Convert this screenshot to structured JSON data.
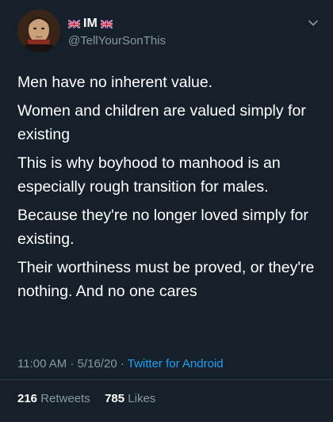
{
  "tweet": {
    "display_name": "IM",
    "handle": "@TellYourSonThis",
    "paragraphs": [
      "Men have no inherent value.",
      "Women and children are valued simply for existing",
      "This is why boyhood to manhood is an especially rough transition for males.",
      "Because they're no longer loved simply for existing.",
      "Their worthiness must be proved, or they're nothing. And no one cares"
    ],
    "time": "11:00 AM",
    "sep1": "·",
    "date": "5/16/20",
    "sep2": "·",
    "source": "Twitter for Android",
    "retweets_count": "216",
    "retweets_label": "Retweets",
    "likes_count": "785",
    "likes_label": "Likes"
  },
  "colors": {
    "background": "#15202b",
    "text": "#ffffff",
    "secondary": "#8899a6",
    "link": "#1da1f2"
  },
  "icons": {
    "avatar": "avatar-portrait",
    "flags": "uk-flag-icon",
    "menu": "chevron-down-icon"
  }
}
